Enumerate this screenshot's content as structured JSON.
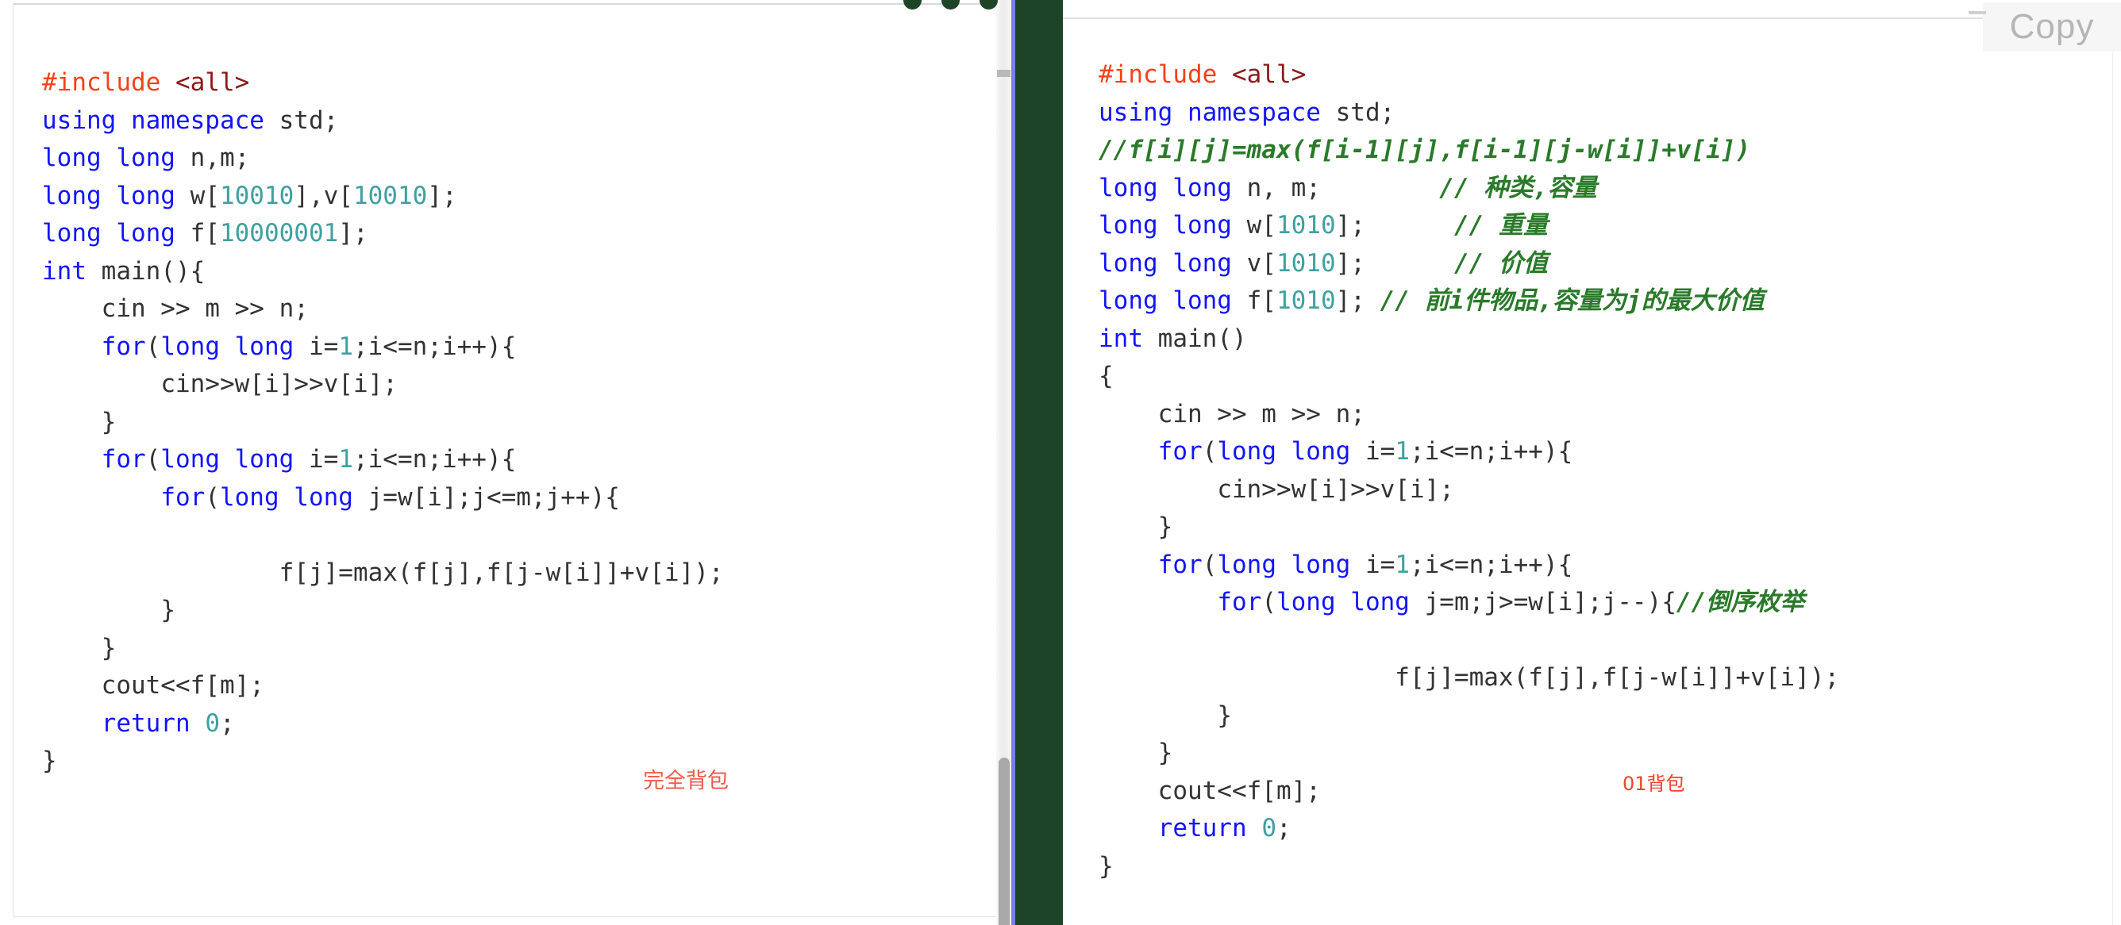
{
  "left_panel": {
    "name": "complete-knapsack-code",
    "annotation": "完全背包",
    "annotation_color": "#f05a4b",
    "code_lines": [
      {
        "indent": 0,
        "tokens": [
          {
            "t": "#include",
            "c": "pre"
          },
          {
            "t": " ",
            "c": "plain"
          },
          {
            "t": "<all>",
            "c": "inc"
          }
        ]
      },
      {
        "indent": 0,
        "tokens": [
          {
            "t": "using namespace",
            "c": "kw"
          },
          {
            "t": " std;",
            "c": "plain"
          }
        ]
      },
      {
        "indent": 0,
        "tokens": [
          {
            "t": "long long",
            "c": "kw"
          },
          {
            "t": " n,m;",
            "c": "plain"
          }
        ]
      },
      {
        "indent": 0,
        "tokens": [
          {
            "t": "long long",
            "c": "kw"
          },
          {
            "t": " w[",
            "c": "plain"
          },
          {
            "t": "10010",
            "c": "num"
          },
          {
            "t": "],v[",
            "c": "plain"
          },
          {
            "t": "10010",
            "c": "num"
          },
          {
            "t": "];",
            "c": "plain"
          }
        ]
      },
      {
        "indent": 0,
        "tokens": [
          {
            "t": "long long",
            "c": "kw"
          },
          {
            "t": " f[",
            "c": "plain"
          },
          {
            "t": "10000001",
            "c": "num"
          },
          {
            "t": "];",
            "c": "plain"
          }
        ]
      },
      {
        "indent": 0,
        "tokens": [
          {
            "t": "int",
            "c": "kw"
          },
          {
            "t": " main(){",
            "c": "plain"
          }
        ]
      },
      {
        "indent": 1,
        "tokens": [
          {
            "t": "cin >> m >> n;",
            "c": "plain"
          }
        ]
      },
      {
        "indent": 1,
        "tokens": [
          {
            "t": "for",
            "c": "kw"
          },
          {
            "t": "(",
            "c": "plain"
          },
          {
            "t": "long long",
            "c": "kw"
          },
          {
            "t": " i=",
            "c": "plain"
          },
          {
            "t": "1",
            "c": "num"
          },
          {
            "t": ";i<=n;i++){",
            "c": "plain"
          }
        ]
      },
      {
        "indent": 2,
        "tokens": [
          {
            "t": "cin>>w[i]>>v[i];",
            "c": "plain"
          }
        ]
      },
      {
        "indent": 1,
        "tokens": [
          {
            "t": "}",
            "c": "plain"
          }
        ]
      },
      {
        "indent": 1,
        "tokens": [
          {
            "t": "for",
            "c": "kw"
          },
          {
            "t": "(",
            "c": "plain"
          },
          {
            "t": "long long",
            "c": "kw"
          },
          {
            "t": " i=",
            "c": "plain"
          },
          {
            "t": "1",
            "c": "num"
          },
          {
            "t": ";i<=n;i++){",
            "c": "plain"
          }
        ]
      },
      {
        "indent": 2,
        "tokens": [
          {
            "t": "for",
            "c": "kw"
          },
          {
            "t": "(",
            "c": "plain"
          },
          {
            "t": "long long",
            "c": "kw"
          },
          {
            "t": " j=w[i];j<=m;j++){",
            "c": "plain"
          }
        ]
      },
      {
        "indent": 0,
        "tokens": []
      },
      {
        "indent": 4,
        "tokens": [
          {
            "t": "f[j]=max(f[j],f[j-w[i]]+v[i]);",
            "c": "plain"
          }
        ]
      },
      {
        "indent": 2,
        "tokens": [
          {
            "t": "}",
            "c": "plain"
          }
        ]
      },
      {
        "indent": 1,
        "tokens": [
          {
            "t": "}",
            "c": "plain"
          }
        ]
      },
      {
        "indent": 1,
        "tokens": [
          {
            "t": "cout<<f[m];",
            "c": "plain"
          }
        ]
      },
      {
        "indent": 1,
        "tokens": [
          {
            "t": "return",
            "c": "kw"
          },
          {
            "t": " ",
            "c": "plain"
          },
          {
            "t": "0",
            "c": "num"
          },
          {
            "t": ";",
            "c": "plain"
          }
        ]
      },
      {
        "indent": 0,
        "tokens": [
          {
            "t": "}",
            "c": "plain"
          }
        ]
      }
    ]
  },
  "right_panel": {
    "name": "01-knapsack-code",
    "annotation": "01背包",
    "annotation_color": "#f0422a",
    "code_lines": [
      {
        "indent": 0,
        "tokens": [
          {
            "t": "#include",
            "c": "pre"
          },
          {
            "t": " ",
            "c": "plain"
          },
          {
            "t": "<all>",
            "c": "inc"
          }
        ]
      },
      {
        "indent": 0,
        "tokens": [
          {
            "t": "using namespace",
            "c": "kw"
          },
          {
            "t": " std;",
            "c": "plain"
          }
        ]
      },
      {
        "indent": 0,
        "tokens": [
          {
            "t": "//f[i][j]=max(f[i-1][j],f[i-1][j-w[i]]+v[i])",
            "c": "cmt"
          }
        ]
      },
      {
        "indent": 0,
        "tokens": [
          {
            "t": "long long",
            "c": "kw"
          },
          {
            "t": " n, m;",
            "c": "plain"
          },
          {
            "t": "        ",
            "c": "plain"
          },
          {
            "t": "// 种类,容量",
            "c": "cmt"
          }
        ]
      },
      {
        "indent": 0,
        "tokens": [
          {
            "t": "long long",
            "c": "kw"
          },
          {
            "t": " w[",
            "c": "plain"
          },
          {
            "t": "1010",
            "c": "num"
          },
          {
            "t": "];",
            "c": "plain"
          },
          {
            "t": "      ",
            "c": "plain"
          },
          {
            "t": "// 重量",
            "c": "cmt"
          }
        ]
      },
      {
        "indent": 0,
        "tokens": [
          {
            "t": "long long",
            "c": "kw"
          },
          {
            "t": " v[",
            "c": "plain"
          },
          {
            "t": "1010",
            "c": "num"
          },
          {
            "t": "];",
            "c": "plain"
          },
          {
            "t": "      ",
            "c": "plain"
          },
          {
            "t": "// 价值",
            "c": "cmt"
          }
        ]
      },
      {
        "indent": 0,
        "tokens": [
          {
            "t": "long long",
            "c": "kw"
          },
          {
            "t": " f[",
            "c": "plain"
          },
          {
            "t": "1010",
            "c": "num"
          },
          {
            "t": "]; ",
            "c": "plain"
          },
          {
            "t": "// 前i件物品,容量为j的最大价值",
            "c": "cmt"
          }
        ]
      },
      {
        "indent": 0,
        "tokens": [
          {
            "t": "int",
            "c": "kw"
          },
          {
            "t": " main()",
            "c": "plain"
          }
        ]
      },
      {
        "indent": 0,
        "tokens": [
          {
            "t": "{",
            "c": "plain"
          }
        ]
      },
      {
        "indent": 1,
        "tokens": [
          {
            "t": "cin >> m >> n;",
            "c": "plain"
          }
        ]
      },
      {
        "indent": 1,
        "tokens": [
          {
            "t": "for",
            "c": "kw"
          },
          {
            "t": "(",
            "c": "plain"
          },
          {
            "t": "long long",
            "c": "kw"
          },
          {
            "t": " i=",
            "c": "plain"
          },
          {
            "t": "1",
            "c": "num"
          },
          {
            "t": ";i<=n;i++){",
            "c": "plain"
          }
        ]
      },
      {
        "indent": 2,
        "tokens": [
          {
            "t": "cin>>w[i]>>v[i];",
            "c": "plain"
          }
        ]
      },
      {
        "indent": 1,
        "tokens": [
          {
            "t": "}",
            "c": "plain"
          }
        ]
      },
      {
        "indent": 1,
        "tokens": [
          {
            "t": "for",
            "c": "kw"
          },
          {
            "t": "(",
            "c": "plain"
          },
          {
            "t": "long long",
            "c": "kw"
          },
          {
            "t": " i=",
            "c": "plain"
          },
          {
            "t": "1",
            "c": "num"
          },
          {
            "t": ";i<=n;i++){",
            "c": "plain"
          }
        ]
      },
      {
        "indent": 2,
        "tokens": [
          {
            "t": "for",
            "c": "kw"
          },
          {
            "t": "(",
            "c": "plain"
          },
          {
            "t": "long long",
            "c": "kw"
          },
          {
            "t": " j=m;j>=w[i];j--){",
            "c": "plain"
          },
          {
            "t": "//倒序枚举",
            "c": "cmt"
          }
        ]
      },
      {
        "indent": 0,
        "tokens": []
      },
      {
        "indent": 5,
        "tokens": [
          {
            "t": "f[j]=max(f[j],f[j-w[i]]+v[i]);",
            "c": "plain"
          }
        ]
      },
      {
        "indent": 2,
        "tokens": [
          {
            "t": "}",
            "c": "plain"
          }
        ]
      },
      {
        "indent": 1,
        "tokens": [
          {
            "t": "}",
            "c": "plain"
          }
        ]
      },
      {
        "indent": 1,
        "tokens": [
          {
            "t": "cout<<f[m];",
            "c": "plain"
          }
        ]
      },
      {
        "indent": 1,
        "tokens": [
          {
            "t": "return",
            "c": "kw"
          },
          {
            "t": " ",
            "c": "plain"
          },
          {
            "t": "0",
            "c": "num"
          },
          {
            "t": ";",
            "c": "plain"
          }
        ]
      },
      {
        "indent": 0,
        "tokens": [
          {
            "t": "}",
            "c": "plain"
          }
        ]
      }
    ]
  },
  "copy_button": {
    "label": "Copy"
  },
  "window_dots": {
    "count": 3,
    "color": "#1d4426"
  },
  "colors": {
    "keyword": "#1414ff",
    "preprocessor": "#f4421a",
    "include_target": "#8b1a1a",
    "number": "#41a0a0",
    "comment": "#2a7a2a",
    "plain": "#333333",
    "divider_green": "#1d4426",
    "divider_blue": "#7b7fe0"
  }
}
